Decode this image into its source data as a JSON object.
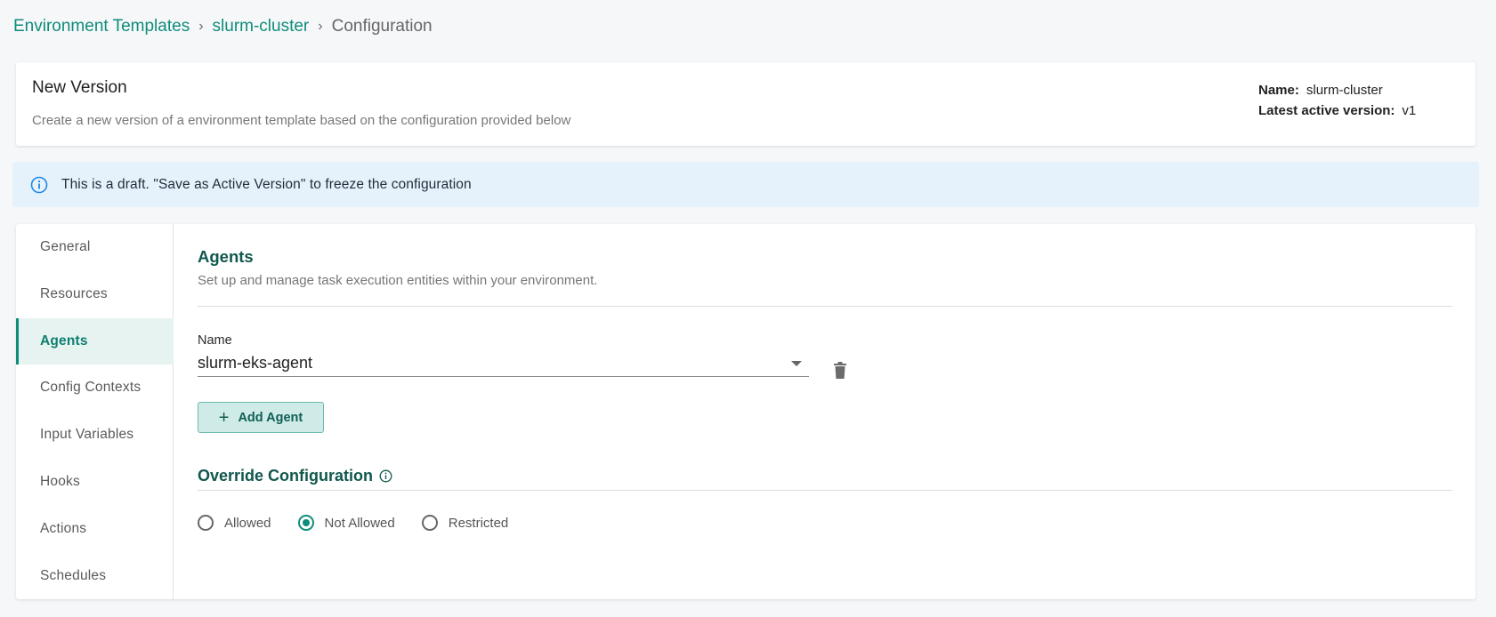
{
  "breadcrumb": {
    "items": [
      "Environment Templates",
      "slurm-cluster"
    ],
    "current": "Configuration",
    "separator": "›"
  },
  "header": {
    "title": "New Version",
    "subtitle": "Create a new version of a environment template based on the configuration provided below",
    "name_label": "Name:",
    "name_value": "slurm-cluster",
    "latest_label": "Latest active version:",
    "latest_value": "v1"
  },
  "banner": {
    "icon": "info-icon",
    "text": "This is a draft. \"Save as Active Version\" to freeze the configuration"
  },
  "sidebar": {
    "items": [
      {
        "label": "General"
      },
      {
        "label": "Resources"
      },
      {
        "label": "Agents",
        "active": true
      },
      {
        "label": "Config Contexts"
      },
      {
        "label": "Input Variables"
      },
      {
        "label": "Hooks"
      },
      {
        "label": "Actions"
      },
      {
        "label": "Schedules"
      }
    ]
  },
  "agents": {
    "title": "Agents",
    "subtitle": "Set up and manage task execution entities within your environment.",
    "name_label": "Name",
    "selected_agent": "slurm-eks-agent",
    "add_button": "Add Agent",
    "override_title": "Override Configuration",
    "options": [
      "Allowed",
      "Not Allowed",
      "Restricted"
    ],
    "selected_option": "Not Allowed"
  },
  "colors": {
    "accent": "#0f8c7a",
    "heading": "#10574d",
    "banner_bg": "#e6f2fb",
    "banner_icon": "#1e88e5"
  }
}
